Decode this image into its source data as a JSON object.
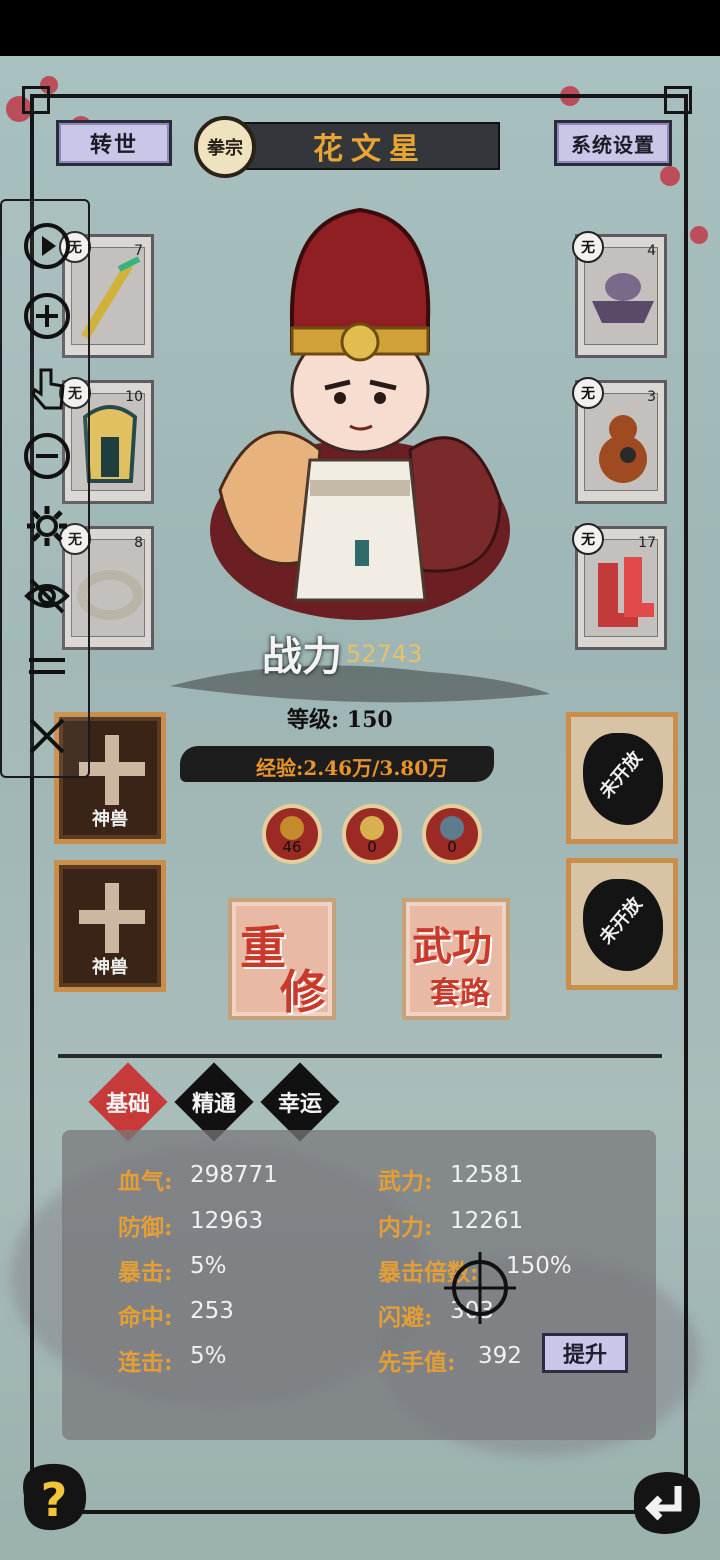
{
  "header": {
    "rebirth_label": "转世",
    "sect_label": "拳宗",
    "character_name": "花文星",
    "system_settings_label": "系统设置"
  },
  "equipment": {
    "slot_marker": "无",
    "left": [
      {
        "item": "sword",
        "count": "7"
      },
      {
        "item": "armor",
        "count": "10"
      },
      {
        "item": "ring",
        "count": "8"
      }
    ],
    "right": [
      {
        "item": "hat",
        "count": "4"
      },
      {
        "item": "gourd",
        "count": "3"
      },
      {
        "item": "boots",
        "count": "17"
      }
    ]
  },
  "power": {
    "label": "战力",
    "value": "52743"
  },
  "level": {
    "text": "等级: 150"
  },
  "experience": {
    "text": "经验:2.46万/3.80万"
  },
  "pets": [
    {
      "label": "神兽"
    },
    {
      "label": "神兽"
    }
  ],
  "locked_slots": [
    {
      "label": "未开放"
    },
    {
      "label": "未开放"
    }
  ],
  "resources": [
    {
      "value": "46",
      "color": "#c58a2c"
    },
    {
      "value": "0",
      "color": "#d9b050"
    },
    {
      "value": "0",
      "color": "#5e7c8e"
    }
  ],
  "actions": {
    "retrain_label_1": "重",
    "retrain_label_2": "修",
    "martial_label_1": "武功",
    "martial_label_2": "套路"
  },
  "tabs": [
    {
      "label": "基础",
      "active": true
    },
    {
      "label": "精通",
      "active": false
    },
    {
      "label": "幸运",
      "active": false
    }
  ],
  "stats": {
    "left": [
      {
        "key": "血气:",
        "value": "298771"
      },
      {
        "key": "防御:",
        "value": "12963"
      },
      {
        "key": "暴击:",
        "value": "5%"
      },
      {
        "key": "命中:",
        "value": "253"
      },
      {
        "key": "连击:",
        "value": "5%"
      }
    ],
    "right": [
      {
        "key": "武力:",
        "value": "12581"
      },
      {
        "key": "内力:",
        "value": "12261"
      },
      {
        "key": "暴击倍数:",
        "value": "150%"
      },
      {
        "key": "闪避:",
        "value": "303"
      },
      {
        "key": "先手值:",
        "value": "392"
      }
    ],
    "upgrade_label": "提升"
  },
  "colors": {
    "accent_orange": "#e39e36",
    "title_gold": "#e8a531",
    "tab_active": "#c63a3a"
  }
}
